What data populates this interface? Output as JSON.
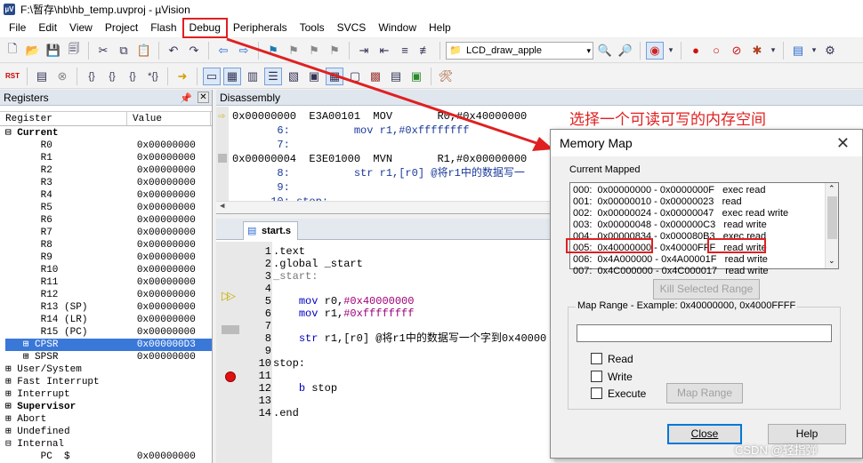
{
  "window": {
    "title": "F:\\暂存\\hb\\hb_temp.uvproj - µVision",
    "icon_text": "µV"
  },
  "menu": [
    "File",
    "Edit",
    "View",
    "Project",
    "Flash",
    "Debug",
    "Peripherals",
    "Tools",
    "SVCS",
    "Window",
    "Help"
  ],
  "toolbar": {
    "target_combo": "LCD_draw_apple",
    "rst_label": "RST"
  },
  "registers": {
    "title": "Registers",
    "col_register": "Register",
    "col_value": "Value",
    "rows": [
      {
        "name": "⊟ Current",
        "value": ""
      },
      {
        "name": "      R0",
        "value": "0x00000000"
      },
      {
        "name": "      R1",
        "value": "0x00000000"
      },
      {
        "name": "      R2",
        "value": "0x00000000"
      },
      {
        "name": "      R3",
        "value": "0x00000000"
      },
      {
        "name": "      R4",
        "value": "0x00000000"
      },
      {
        "name": "      R5",
        "value": "0x00000000"
      },
      {
        "name": "      R6",
        "value": "0x00000000"
      },
      {
        "name": "      R7",
        "value": "0x00000000"
      },
      {
        "name": "      R8",
        "value": "0x00000000"
      },
      {
        "name": "      R9",
        "value": "0x00000000"
      },
      {
        "name": "      R10",
        "value": "0x00000000"
      },
      {
        "name": "      R11",
        "value": "0x00000000"
      },
      {
        "name": "      R12",
        "value": "0x00000000"
      },
      {
        "name": "      R13 (SP)",
        "value": "0x00000000"
      },
      {
        "name": "      R14 (LR)",
        "value": "0x00000000"
      },
      {
        "name": "      R15 (PC)",
        "value": "0x00000000"
      },
      {
        "name": "   ⊞ CPSR",
        "value": "0x000000D3"
      },
      {
        "name": "   ⊞ SPSR",
        "value": "0x00000000"
      },
      {
        "name": "⊞ User/System",
        "value": ""
      },
      {
        "name": "⊞ Fast Interrupt",
        "value": ""
      },
      {
        "name": "⊞ Interrupt",
        "value": ""
      },
      {
        "name": "⊞ Supervisor",
        "value": ""
      },
      {
        "name": "⊞ Abort",
        "value": ""
      },
      {
        "name": "⊞ Undefined",
        "value": ""
      },
      {
        "name": "⊟ Internal",
        "value": ""
      },
      {
        "name": "      PC  $",
        "value": "0x00000000"
      }
    ]
  },
  "disassembly": {
    "title": "Disassembly",
    "lines": [
      "0x00000000  E3A00101  MOV       R0,#0x40000000",
      "       6:          mov r1,#0xffffffff",
      "       7:",
      "0x00000004  E3E01000  MVN       R1,#0x00000000",
      "       8:          str r1,[r0] @将r1中的数据写一",
      "       9:",
      "      10: stop:"
    ]
  },
  "source": {
    "tab": "start.s",
    "line_numbers": [
      "1",
      "2",
      "3",
      "4",
      "5",
      "6",
      "7",
      "8",
      "9",
      "10",
      "11",
      "12",
      "13",
      "14"
    ],
    "lines": [
      ".text",
      ".global _start",
      "_start:",
      "",
      "    mov r0,#0x40000000",
      "    mov r1,#0xffffffff",
      "",
      "    str r1,[r0] @将r1中的数据写一个字到0x40000",
      "",
      "stop:",
      "",
      "    b stop",
      "",
      ".end"
    ]
  },
  "dialog": {
    "title": "Memory Map",
    "current_label": "Current Mapped",
    "map_rows": [
      "000:  0x00000000 - 0x0000000F   exec read",
      "001:  0x00000010 - 0x00000023   read",
      "002:  0x00000024 - 0x00000047   exec read write",
      "003:  0x00000048 - 0x000000C3   read write",
      "004:  0x00000834 - 0x000080B3   exec read",
      "005:  0x40000000 - 0x40000FFF   read write",
      "006:  0x4A000000 - 0x4A00001F   read write",
      "007:  0x4C000000 - 0x4C000017   read write"
    ],
    "kill_button": "Kill Selected Range",
    "range_label": "Map Range - Example:  0x40000000, 0x4000FFFF",
    "range_value": "",
    "read_label": "Read",
    "write_label": "Write",
    "execute_label": "Execute",
    "map_button": "Map Range",
    "close_button": "Close",
    "help_button": "Help"
  },
  "annotation": "选择一个可读可写的内存空间",
  "watermark": "CSDN @轻指弹",
  "colors": {
    "highlight_red": "#e02020",
    "selection_blue": "#3a78d8"
  }
}
